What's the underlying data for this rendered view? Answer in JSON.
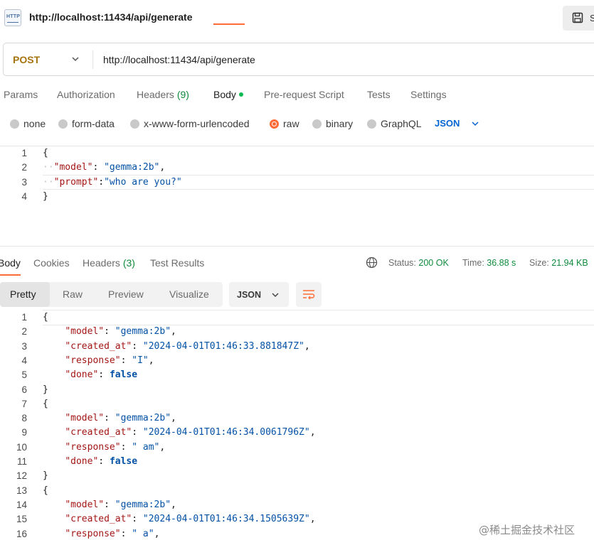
{
  "header": {
    "tab_icon": "http-file-icon",
    "tab_icon_text": "HTTP",
    "tab_title": "http://localhost:11434/api/generate",
    "save_label": "S"
  },
  "request": {
    "method": "POST",
    "url": "http://localhost:11434/api/generate",
    "tabs": [
      {
        "label": "Params"
      },
      {
        "label": "Authorization"
      },
      {
        "label": "Headers",
        "count": "(9)"
      },
      {
        "label": "Body",
        "active": true
      },
      {
        "label": "Pre-request Script"
      },
      {
        "label": "Tests"
      },
      {
        "label": "Settings"
      }
    ],
    "body_types": [
      "none",
      "form-data",
      "x-www-form-urlencoded",
      "raw",
      "binary",
      "GraphQL"
    ],
    "selected_body_type": "raw",
    "format": "JSON",
    "body_lines": [
      {
        "num": "1",
        "text": "{"
      },
      {
        "num": "2",
        "text": "  \"model\": \"gemma:2b\","
      },
      {
        "num": "3",
        "text": "  \"prompt\":\"who are you?\""
      },
      {
        "num": "4",
        "text": "}"
      }
    ]
  },
  "response": {
    "tabs": [
      {
        "label": "Body",
        "active": true
      },
      {
        "label": "Cookies"
      },
      {
        "label": "Headers",
        "count": "(3)"
      },
      {
        "label": "Test Results"
      }
    ],
    "status_label": "Status:",
    "status_value": "200 OK",
    "time_label": "Time:",
    "time_value": "36.88 s",
    "size_label": "Size:",
    "size_value": "21.94 KB",
    "views": [
      "Pretty",
      "Raw",
      "Preview",
      "Visualize"
    ],
    "active_view": "Pretty",
    "format": "JSON",
    "lines": [
      {
        "num": "1",
        "text": "{"
      },
      {
        "num": "2",
        "text": "    \"model\": \"gemma:2b\","
      },
      {
        "num": "3",
        "text": "    \"created_at\": \"2024-04-01T01:46:33.881847Z\","
      },
      {
        "num": "4",
        "text": "    \"response\": \"I\","
      },
      {
        "num": "5",
        "text": "    \"done\": false"
      },
      {
        "num": "6",
        "text": "}"
      },
      {
        "num": "7",
        "text": "{"
      },
      {
        "num": "8",
        "text": "    \"model\": \"gemma:2b\","
      },
      {
        "num": "9",
        "text": "    \"created_at\": \"2024-04-01T01:46:34.0061796Z\","
      },
      {
        "num": "10",
        "text": "    \"response\": \" am\","
      },
      {
        "num": "11",
        "text": "    \"done\": false"
      },
      {
        "num": "12",
        "text": "}"
      },
      {
        "num": "13",
        "text": "{"
      },
      {
        "num": "14",
        "text": "    \"model\": \"gemma:2b\","
      },
      {
        "num": "15",
        "text": "    \"created_at\": \"2024-04-01T01:46:34.1505639Z\","
      },
      {
        "num": "16",
        "text": "    \"response\": \" a\","
      }
    ]
  },
  "watermark": "@稀土掘金技术社区",
  "colors": {
    "accent": "#ff6c37",
    "method": "#a5740d",
    "status_ok": "#0f8b3c",
    "json_key": "#a31515",
    "json_string": "#0451a5",
    "link_blue": "#0265d2"
  }
}
